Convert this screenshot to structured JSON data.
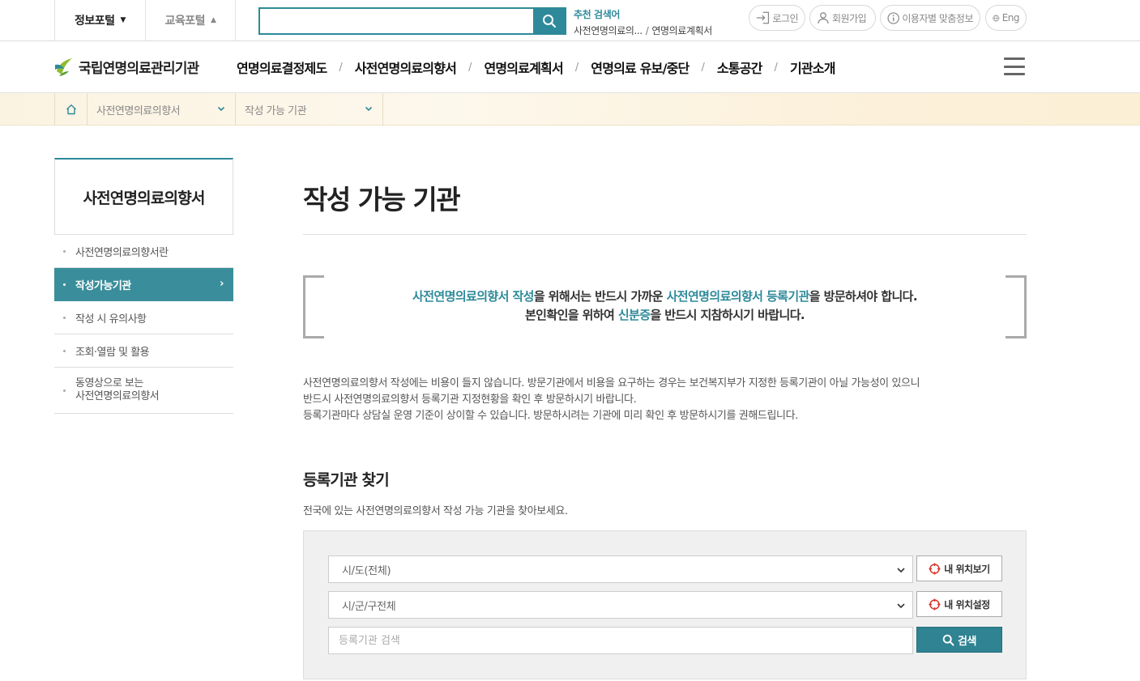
{
  "topbar": {
    "portal_tabs": [
      {
        "label": "정보포털",
        "caret": "▼"
      },
      {
        "label": "교육포털",
        "caret": "▲"
      }
    ],
    "search": {
      "placeholder": "",
      "value": ""
    },
    "recommend": {
      "title": "추천 검색어",
      "words": [
        "사전연명의료의...",
        "연명의료계획서"
      ]
    },
    "utility": {
      "login": "로그인",
      "join": "회원가입",
      "custom_info": "이용자별 맞춤정보",
      "eng": "Eng"
    }
  },
  "gnb": {
    "logo": "국립연명의료관리기관",
    "menu": [
      "연명의료결정제도",
      "사전연명의료의향서",
      "연명의료계획서",
      "연명의료 유보/중단",
      "소통공간",
      "기관소개"
    ],
    "separator": "/"
  },
  "breadcrumb": {
    "level1": "사전연명의료의향서",
    "level2": "작성 가능 기관"
  },
  "lnb": {
    "title": "사전연명의료의향서",
    "items": [
      {
        "label": "사전연명의료의향서란"
      },
      {
        "label": "작성가능기관",
        "active": true
      },
      {
        "label": "작성 시 유의사항"
      },
      {
        "label": "조회·열람 및 활용"
      },
      {
        "label_line1": "동영상으로 보는",
        "label_line2": "사전연명의료의향서"
      }
    ]
  },
  "content": {
    "page_title": "작성 가능 기관",
    "quote": {
      "l1_hl1": "사전연명의료의향서 작성",
      "l1_t1": "을 위해서는 반드시 가까운 ",
      "l1_hl2": "사전연명의료의향서 등록기관",
      "l1_t2": "을 방문하셔야 합니다.",
      "l2_t1": "본인확인을 위하여 ",
      "l2_hl": "신분증",
      "l2_t2": "을 반드시 지참하시기 바랍니다."
    },
    "notice": [
      "사전연명의료의향서 작성에는 비용이 들지 않습니다. 방문기관에서 비용을 요구하는 경우는 보건복지부가 지정한 등록기관이 아닐 가능성이 있으니",
      "반드시 사전연명의료의향서 등록기관 지정현황을 확인 후 방문하시기 바랍니다.",
      "등록기관마다 상담실 운영 기준이 상이할 수 있습니다. 방문하시려는 기관에 미리 확인 후 방문하시기를 권해드립니다."
    ],
    "section_title": "등록기관 찾기",
    "section_desc": "전국에 있는 사전연명의료의향서 작성 가능 기관을 찾아보세요.",
    "search_form": {
      "sido": "시/도(전체)",
      "sigungu": "시/군/구전체",
      "keyword_placeholder": "등록기관 검색",
      "my_location_view": "내 위치보기",
      "my_location_set": "내 위치설정",
      "search_button": "검색"
    }
  },
  "colors": {
    "accent": "#2e8a9a",
    "lnb_active": "#3a8e9b",
    "breadcrumb_bg": "#fbf3e2"
  }
}
